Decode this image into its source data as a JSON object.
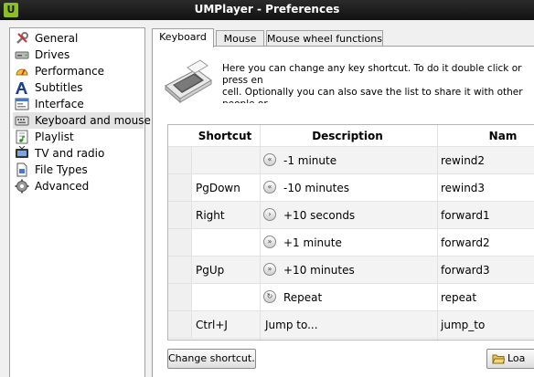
{
  "window": {
    "app_icon": "U",
    "title": "UMPlayer - Preferences"
  },
  "sidebar": {
    "items": [
      {
        "label": "General",
        "icon": "wrench-screwdriver-icon"
      },
      {
        "label": "Drives",
        "icon": "drive-icon"
      },
      {
        "label": "Performance",
        "icon": "speedometer-icon"
      },
      {
        "label": "Subtitles",
        "icon": "subtitles-icon"
      },
      {
        "label": "Interface",
        "icon": "interface-icon"
      },
      {
        "label": "Keyboard and mouse",
        "icon": "keyboard-icon",
        "selected": true
      },
      {
        "label": "Playlist",
        "icon": "playlist-icon"
      },
      {
        "label": "TV and radio",
        "icon": "tv-icon"
      },
      {
        "label": "File Types",
        "icon": "file-types-icon"
      },
      {
        "label": "Advanced",
        "icon": "gear-icon"
      }
    ]
  },
  "tabs": [
    {
      "label": "Keyboard",
      "active": true
    },
    {
      "label": "Mouse",
      "active": false
    },
    {
      "label": "Mouse wheel functions",
      "active": false
    }
  ],
  "keyboard": {
    "intro": "Here you can change any key shortcut. To do it double click or press en\ncell. Optionally you can also save the list to share it with other people or\ncomputer.",
    "columns": {
      "shortcut": "Shortcut",
      "description": "Description",
      "name": "Nam"
    },
    "rows": [
      {
        "shortcut": "",
        "icon": "rewind-icon",
        "description": "-1 minute",
        "name": "rewind2"
      },
      {
        "shortcut": "PgDown",
        "icon": "rewind-icon",
        "description": "-10 minutes",
        "name": "rewind3"
      },
      {
        "shortcut": "Right",
        "icon": "forward-icon",
        "description": "+10 seconds",
        "name": "forward1"
      },
      {
        "shortcut": "",
        "icon": "forward-icon",
        "description": "+1 minute",
        "name": "forward2"
      },
      {
        "shortcut": "PgUp",
        "icon": "forward-icon",
        "description": "+10 minutes",
        "name": "forward3"
      },
      {
        "shortcut": "",
        "icon": "repeat-icon",
        "description": "Repeat",
        "name": "repeat"
      },
      {
        "shortcut": "Ctrl+J",
        "icon": "",
        "description": "Jump to...",
        "name": "jump_to"
      }
    ],
    "change_shortcut_label": "Change shortcut...",
    "load_label": "Loa"
  }
}
